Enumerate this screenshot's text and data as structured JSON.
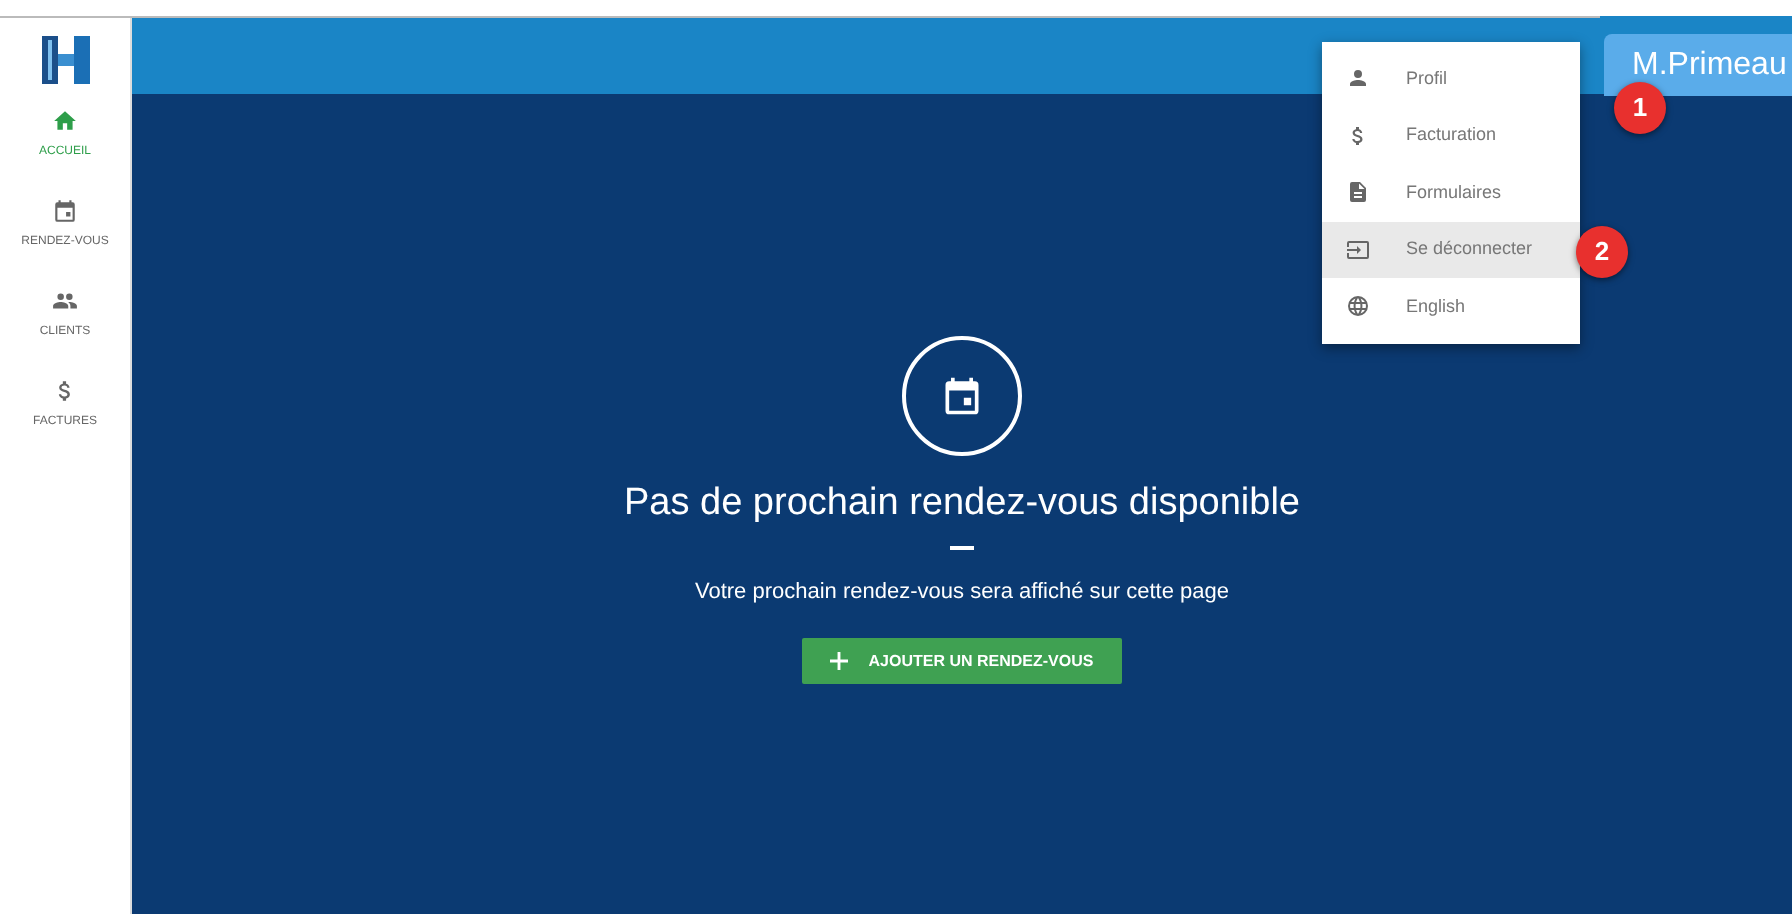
{
  "sidebar": {
    "items": [
      {
        "label": "ACCUEIL",
        "selected": true
      },
      {
        "label": "RENDEZ-VOUS",
        "selected": false
      },
      {
        "label": "CLIENTS",
        "selected": false
      },
      {
        "label": "FACTURES",
        "selected": false
      }
    ]
  },
  "user_button": {
    "label": "M.Primeau"
  },
  "user_menu": {
    "items": [
      {
        "label": "Profil",
        "selected": false
      },
      {
        "label": "Facturation",
        "selected": false
      },
      {
        "label": "Formulaires",
        "selected": false
      },
      {
        "label": "Se déconnecter",
        "selected": true
      },
      {
        "label": "English",
        "selected": false
      }
    ]
  },
  "callouts": [
    "1",
    "2"
  ],
  "empty_state": {
    "title": "Pas de prochain rendez-vous disponible",
    "message": "Votre prochain rendez-vous sera affiché sur cette page",
    "button": "AJOUTER UN RENDEZ-VOUS"
  }
}
